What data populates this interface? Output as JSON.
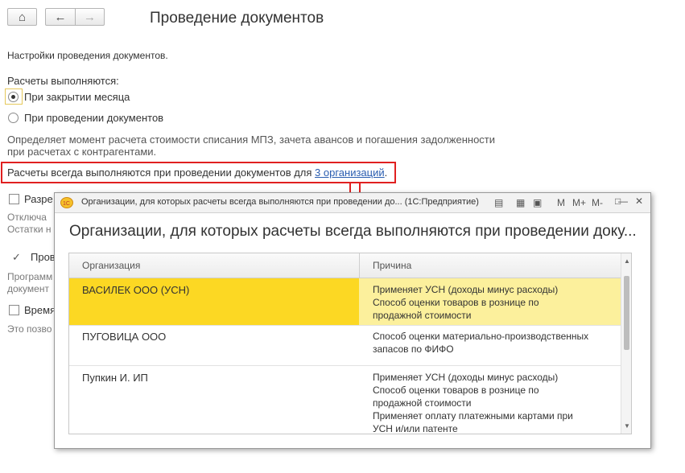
{
  "toolbar": {
    "home_icon": "home-icon",
    "back_icon": "arrow-left-icon",
    "forward_icon": "arrow-right-icon"
  },
  "page": {
    "title": "Проведение документов",
    "settings_caption": "Настройки проведения документов.",
    "calc_label": "Расчеты выполняются:",
    "radio_month_close": "При закрытии месяца",
    "radio_posting": "При проведении документов",
    "description_line1": "Определяет момент расчета стоимости списания МПЗ, зачета авансов и погашения задолженности",
    "description_line2": "при расчетах с контрагентами.",
    "always_text": "Расчеты всегда выполняются при проведении документов для ",
    "always_link": "3 организаций",
    "always_dot": ".",
    "partial_1": "Разре",
    "partial_2": "Отключа",
    "partial_3": "Остатки н",
    "partial_4": "Прове",
    "partial_5": "Программ",
    "partial_6": "документ",
    "partial_7": "Время",
    "partial_8": "Это позво"
  },
  "popup": {
    "window_title": "Организации, для которых расчеты всегда выполняются при проведении до... (1С:Предприятие)",
    "heading": "Организации, для которых расчеты всегда выполняются при проведении доку...",
    "toolbar_m": "M",
    "toolbar_mplus": "M+",
    "toolbar_mminus": "M-",
    "columns": [
      "Организация",
      "Причина"
    ],
    "rows": [
      {
        "org": "ВАСИЛЕК ООО (УСН)",
        "reason": [
          "Применяет УСН (доходы минус расходы)",
          "Способ оценки товаров в рознице по",
          "продажной стоимости"
        ]
      },
      {
        "org": "ПУГОВИЦА ООО",
        "reason": [
          "Способ оценки материально-производственных",
          "запасов по ФИФО"
        ]
      },
      {
        "org": "Пупкин И. ИП",
        "reason": [
          "Применяет УСН (доходы минус расходы)",
          "Способ оценки товаров в рознице по",
          "продажной стоимости",
          "Применяет оплату платежными картами при",
          "УСН и/или патенте"
        ]
      }
    ]
  },
  "colors": {
    "selected_row": "#fcd823",
    "selected_row_light": "#fcf09c",
    "highlight_border": "#e02020",
    "link": "#2a5db0"
  }
}
